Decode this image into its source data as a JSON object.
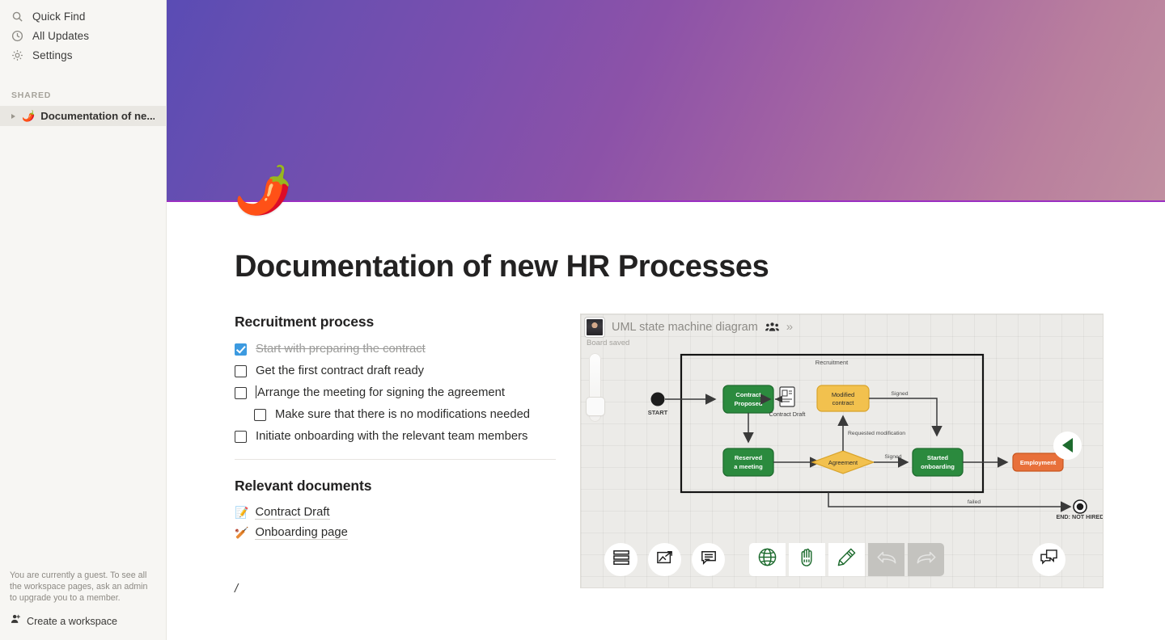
{
  "sidebar": {
    "nav": [
      {
        "label": "Quick Find",
        "icon": "search-icon"
      },
      {
        "label": "All Updates",
        "icon": "clock-icon"
      },
      {
        "label": "Settings",
        "icon": "gear-icon"
      }
    ],
    "section_label": "SHARED",
    "page": {
      "emoji": "🌶️",
      "name": "Documentation of ne..."
    },
    "guest_note": "You are currently a guest. To see all the workspace pages, ask an admin to upgrade you to a member.",
    "create_workspace": "Create a workspace"
  },
  "document": {
    "icon": "🌶️",
    "title": "Documentation of new HR Processes",
    "sections": {
      "recruitment": {
        "heading": "Recruitment process",
        "todos": [
          {
            "label": "Start with preparing the contract",
            "checked": true,
            "indent": false,
            "caret": false
          },
          {
            "label": "Get the first contract draft ready",
            "checked": false,
            "indent": false,
            "caret": false
          },
          {
            "label": "Arrange the meeting for signing the agreement",
            "checked": false,
            "indent": false,
            "caret": true
          },
          {
            "label": "Make sure that there is no modifications needed",
            "checked": false,
            "indent": true,
            "caret": false
          },
          {
            "label": "Initiate onboarding with the relevant team members",
            "checked": false,
            "indent": false,
            "caret": false
          }
        ]
      },
      "documents": {
        "heading": "Relevant documents",
        "links": [
          {
            "emoji": "📝",
            "label": "Contract Draft"
          },
          {
            "emoji": "🏏",
            "label": "Onboarding page"
          }
        ]
      }
    },
    "slash_placeholder": "/"
  },
  "whiteboard": {
    "title": "UML state machine diagram",
    "chevron": "»",
    "status": "Board saved",
    "diagram": {
      "frame_label": "Recruitment",
      "start_label": "START",
      "end_label": "END: NOT HIRED",
      "nodes": [
        {
          "id": "contract-proposed",
          "label": "Contract\nProposed",
          "color": "#2b8a3e"
        },
        {
          "id": "reserved-meeting",
          "label": "Reserved\na meeting",
          "color": "#2b8a3e"
        },
        {
          "id": "modified-contract",
          "label": "Modified\ncontract",
          "color": "#f2c14e"
        },
        {
          "id": "agreement",
          "label": "Agreement",
          "color": "#f2c14e"
        },
        {
          "id": "started-onboarding",
          "label": "Started\nonboarding",
          "color": "#2b8a3e"
        },
        {
          "id": "employment",
          "label": "Employment",
          "color": "#e8703a"
        }
      ],
      "artifact_label": "Contract Draft",
      "edge_labels": [
        "Signed",
        "Requested modification",
        "Signed",
        "failed"
      ]
    },
    "toolbar": [
      {
        "name": "menu-button",
        "icon": "stack-icon"
      },
      {
        "name": "export-button",
        "icon": "share-image-icon"
      },
      {
        "name": "comment-button",
        "icon": "speech-bubble-icon"
      },
      {
        "name": "globe-button",
        "icon": "globe-icon"
      },
      {
        "name": "pan-button",
        "icon": "hand-icon"
      },
      {
        "name": "draw-button",
        "icon": "pencil-icon"
      },
      {
        "name": "undo-button",
        "icon": "undo-icon",
        "disabled": true
      },
      {
        "name": "redo-button",
        "icon": "redo-icon",
        "disabled": true
      },
      {
        "name": "chat-button",
        "icon": "chat-bubbles-icon"
      }
    ],
    "collapse_arrow": "left-triangle-icon"
  },
  "colors": {
    "accent_checkbox": "#3c9ae0",
    "banner_left": "#5a4cb4",
    "banner_right": "#c08fa0",
    "node_green": "#2b8a3e",
    "node_yellow": "#f2c14e",
    "node_orange": "#e8703a"
  }
}
